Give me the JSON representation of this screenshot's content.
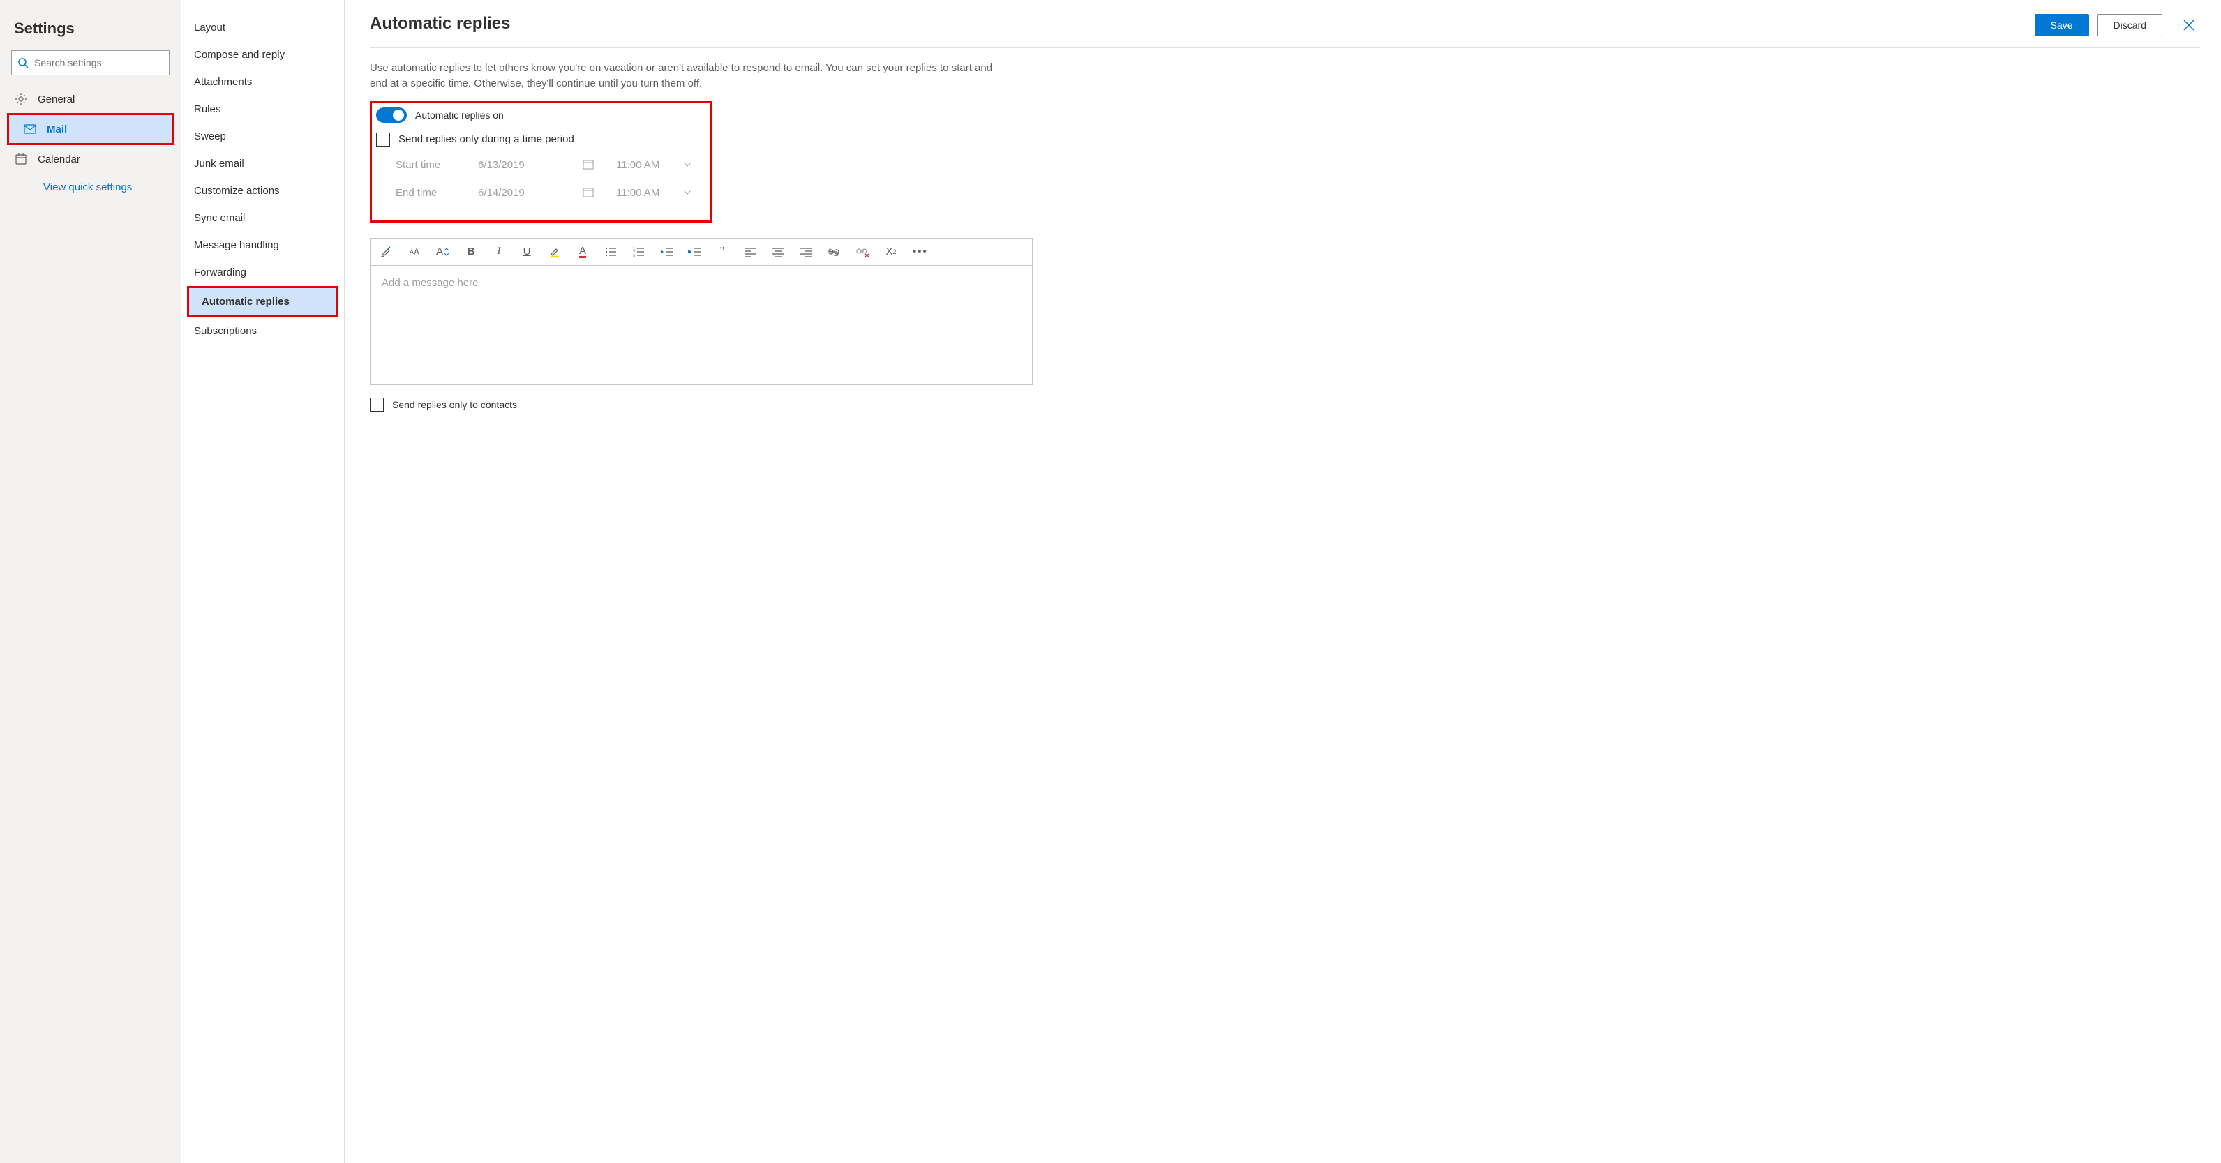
{
  "title": "Settings",
  "search": {
    "placeholder": "Search settings"
  },
  "nav": {
    "general": "General",
    "mail": "Mail",
    "calendar": "Calendar",
    "quick": "View quick settings"
  },
  "mid": {
    "layout": "Layout",
    "compose": "Compose and reply",
    "attachments": "Attachments",
    "rules": "Rules",
    "sweep": "Sweep",
    "junk": "Junk email",
    "customize": "Customize actions",
    "sync": "Sync email",
    "handling": "Message handling",
    "forwarding": "Forwarding",
    "auto": "Automatic replies",
    "subs": "Subscriptions"
  },
  "main": {
    "title": "Automatic replies",
    "save": "Save",
    "discard": "Discard",
    "desc": "Use automatic replies to let others know you're on vacation or aren't available to respond to email. You can set your replies to start and end at a specific time. Otherwise, they'll continue until you turn them off.",
    "toggle_label": "Automatic replies on",
    "period_label": "Send replies only during a time period",
    "start_label": "Start time",
    "end_label": "End time",
    "start_date": "6/13/2019",
    "end_date": "6/14/2019",
    "start_time": "11:00 AM",
    "end_time": "11:00 AM",
    "editor_placeholder": "Add a message here",
    "contacts_label": "Send replies only to contacts"
  }
}
